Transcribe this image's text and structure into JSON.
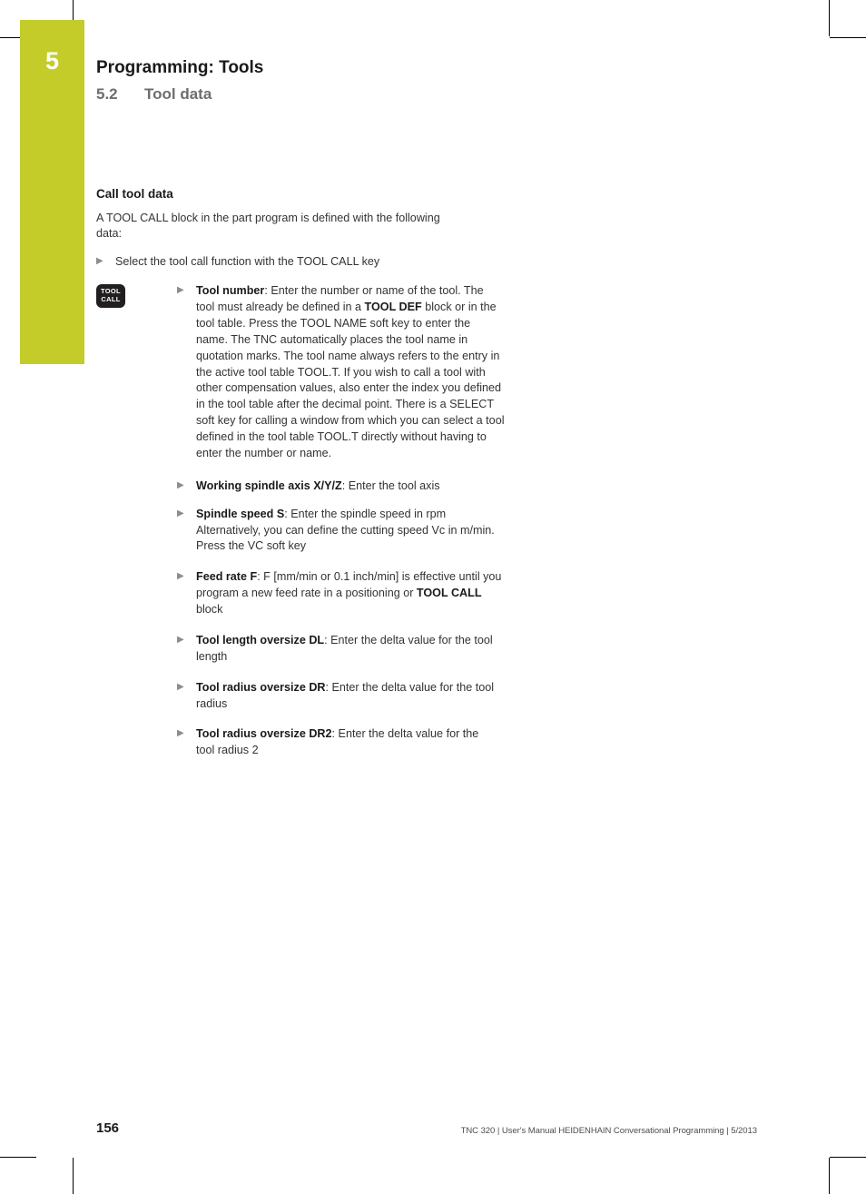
{
  "page": {
    "chapter_number": "5",
    "title": "Programming: Tools",
    "section_number": "5.2",
    "section_title": "Tool data",
    "accent_color": "#c3cc28",
    "subtitle_color": "#6e6e6e"
  },
  "content": {
    "heading": "Call tool data",
    "intro": "A TOOL CALL block in the part program is defined with the following data:",
    "first_bullet": "Select the tool call function with the TOOL CALL key",
    "key_icon": {
      "line1": "TOOL",
      "line2": "CALL",
      "name": "tool-call-key"
    },
    "bullets": [
      {
        "label": "Tool number",
        "text_1": ": Enter the number or name of the tool. The tool must already be defined in a ",
        "bold_2": "TOOL DEF",
        "text_3": " block or in the tool table. Press the TOOL NAME soft key to enter the name. The TNC automatically places the tool name in quotation marks. The tool name always refers to the entry in the active tool table TOOL.T. If you wish to call a tool with other compensation values, also enter the index you defined in the tool table after the decimal point. There is a SELECT soft key for calling a window from which you can select a tool defined in the tool table TOOL.T directly without having to enter the number or name."
      },
      {
        "label": "Working spindle axis X/Y/Z",
        "text_1": ": Enter the tool axis"
      },
      {
        "label": "Spindle speed S",
        "text_1": ": Enter the spindle speed in rpm Alternatively, you can define the cutting speed Vc in m/min. Press the VC soft key"
      },
      {
        "label": "Feed rate F",
        "text_1": ": F [mm/min or 0.1 inch/min] is effective until you program a new feed rate in a positioning or ",
        "bold_2": "TOOL CALL",
        "text_3": " block"
      },
      {
        "label": "Tool length oversize DL",
        "text_1": ": Enter the delta value for the tool length"
      },
      {
        "label": "Tool radius oversize DR",
        "text_1": ": Enter the delta value for the tool radius"
      },
      {
        "label": "Tool radius oversize DR2",
        "text_1": ": Enter the delta value for the tool radius 2"
      }
    ],
    "bullet_glyph": "▶"
  },
  "footer": {
    "page_number": "156",
    "info": "TNC 320 | User's Manual HEIDENHAIN Conversational Programming | 5/2013"
  }
}
